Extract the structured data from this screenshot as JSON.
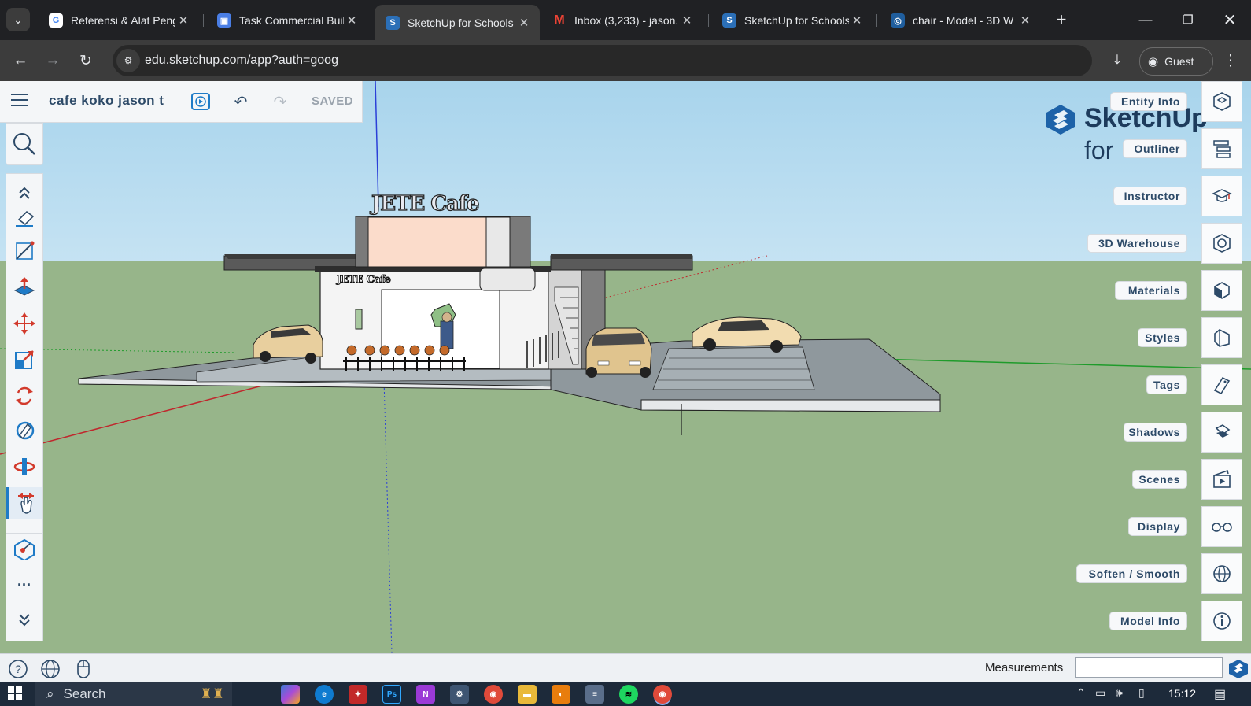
{
  "browser": {
    "tabs": [
      {
        "title": "Referensi & Alat Peng",
        "icon": "google-icon",
        "color": "#ffffff",
        "fg": "#4285f4",
        "glyph": "G"
      },
      {
        "title": "Task Commercial Buil",
        "icon": "classroom-icon",
        "color": "#4a7ee5",
        "fg": "#ffffff",
        "glyph": "▣"
      },
      {
        "title": "SketchUp for Schools",
        "icon": "sketchup-icon",
        "color": "#2b6fb7",
        "fg": "#ffffff",
        "glyph": "S",
        "active": true
      },
      {
        "title": "Inbox (3,233) - jason.",
        "icon": "gmail-icon",
        "color": "#202124",
        "fg": "#ea4335",
        "glyph": "M"
      },
      {
        "title": "SketchUp for Schools",
        "icon": "sketchup-icon",
        "color": "#2b6fb7",
        "fg": "#ffffff",
        "glyph": "S"
      },
      {
        "title": "chair - Model - 3D W",
        "icon": "3d-warehouse-icon",
        "color": "#1f5e9e",
        "fg": "#ffffff",
        "glyph": "◎"
      }
    ],
    "new_tab": "+",
    "url": "edu.sketchup.com/app?auth=goog",
    "profile_label": "Guest"
  },
  "sketchup": {
    "model_name": "cafe koko jason t",
    "save_status": "SAVED",
    "brand_line1": "SketchUp",
    "brand_line2": "for",
    "sign_text": "JETE Cafe",
    "panels": [
      {
        "label": "Entity Info",
        "icon": "entity-info-icon"
      },
      {
        "label": "Outliner",
        "icon": "outliner-icon"
      },
      {
        "label": "Instructor",
        "icon": "instructor-icon"
      },
      {
        "label": "3D Warehouse",
        "icon": "3d-warehouse-icon"
      },
      {
        "label": "Materials",
        "icon": "materials-icon"
      },
      {
        "label": "Styles",
        "icon": "styles-icon"
      },
      {
        "label": "Tags",
        "icon": "tags-icon"
      },
      {
        "label": "Shadows",
        "icon": "shadows-icon"
      },
      {
        "label": "Scenes",
        "icon": "scenes-icon"
      },
      {
        "label": "Display",
        "icon": "display-icon"
      },
      {
        "label": "Soften / Smooth",
        "icon": "soften-smooth-icon"
      },
      {
        "label": "Model Info",
        "icon": "model-info-icon"
      }
    ],
    "tools": [
      "collapse-up",
      "eraser",
      "line",
      "push-pull",
      "move",
      "scale",
      "rotate",
      "paint-bucket",
      "orbit",
      "pan",
      "tape-measure",
      "more",
      "expand-down"
    ],
    "active_tool": "pan",
    "measurements_label": "Measurements",
    "measurements_value": ""
  },
  "taskbar": {
    "search_placeholder": "Search",
    "time": "15:12"
  },
  "colors": {
    "accent": "#1f7bc7",
    "toolbar_text": "#2d4a68",
    "ground": "#97b58a"
  }
}
